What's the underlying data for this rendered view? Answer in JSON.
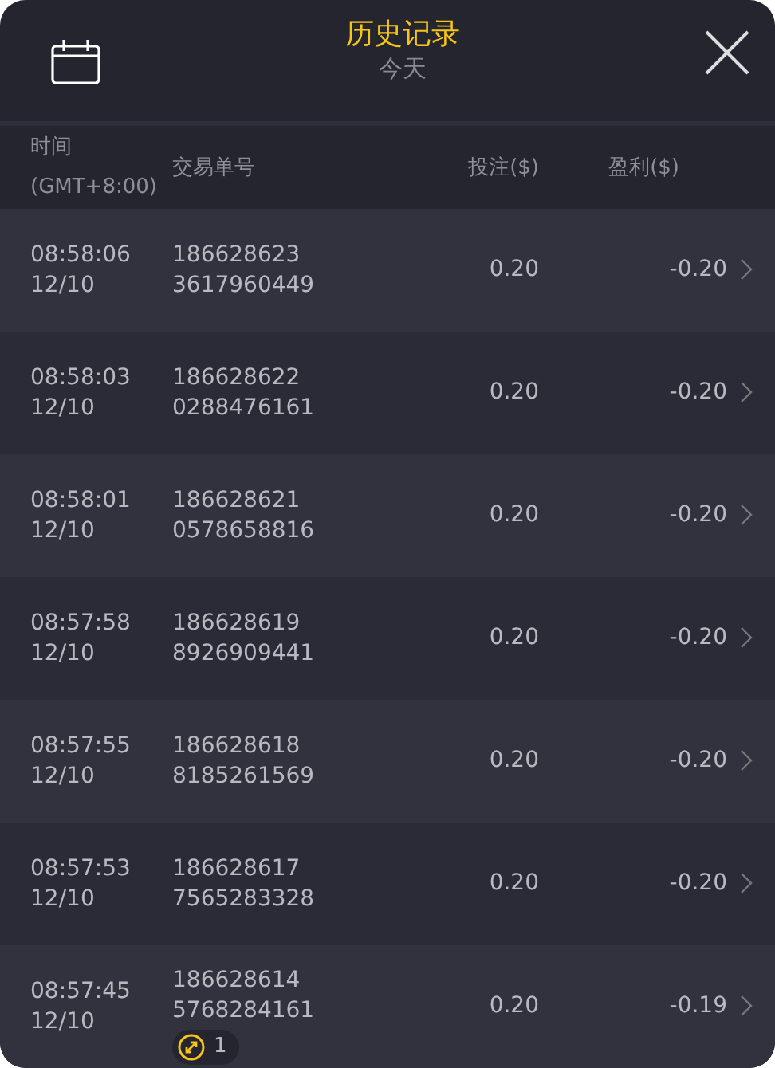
{
  "header": {
    "title": "历史记录",
    "subtitle": "今天"
  },
  "columns": [
    {
      "lines": [
        "时间",
        "(GMT+8:00)"
      ]
    },
    {
      "lines": [
        "交易单号"
      ]
    },
    {
      "lines": [
        "投注($)"
      ]
    },
    {
      "lines": [
        "盈利($)"
      ]
    }
  ],
  "rows": [
    {
      "time": "08:58:06",
      "date": "12/10",
      "id1": "186628623",
      "id2": "3617960449",
      "bet": "0.20",
      "profit": "-0.20"
    },
    {
      "time": "08:58:03",
      "date": "12/10",
      "id1": "186628622",
      "id2": "0288476161",
      "bet": "0.20",
      "profit": "-0.20"
    },
    {
      "time": "08:58:01",
      "date": "12/10",
      "id1": "186628621",
      "id2": "0578658816",
      "bet": "0.20",
      "profit": "-0.20"
    },
    {
      "time": "08:57:58",
      "date": "12/10",
      "id1": "186628619",
      "id2": "8926909441",
      "bet": "0.20",
      "profit": "-0.20"
    },
    {
      "time": "08:57:55",
      "date": "12/10",
      "id1": "186628618",
      "id2": "8185261569",
      "bet": "0.20",
      "profit": "-0.20"
    },
    {
      "time": "08:57:53",
      "date": "12/10",
      "id1": "186628617",
      "id2": "7565283328",
      "bet": "0.20",
      "profit": "-0.20"
    },
    {
      "time": "08:57:45",
      "date": "12/10",
      "id1": "186628614",
      "id2": "5768284161",
      "bet": "0.20",
      "profit": "-0.19",
      "badge": "1"
    }
  ]
}
